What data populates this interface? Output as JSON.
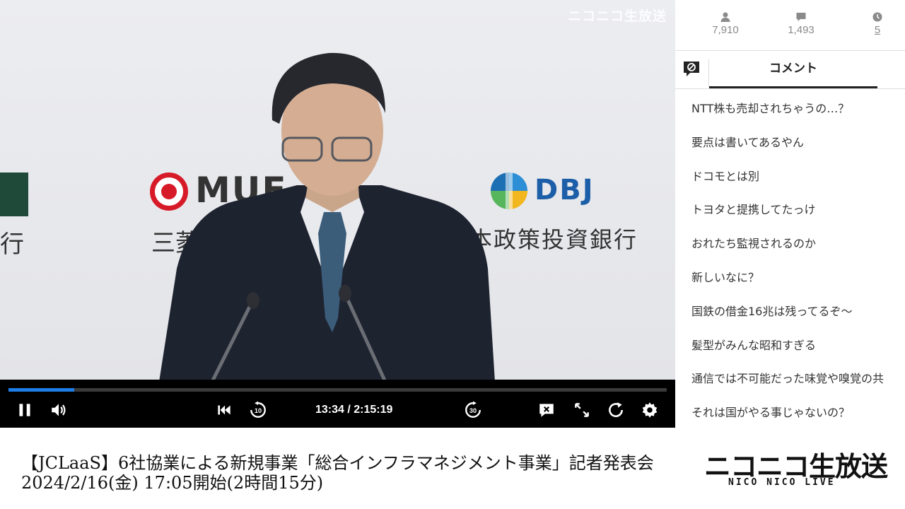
{
  "video": {
    "watermark": "ニコニコ生放送",
    "backdrop": {
      "left_kanji": "行",
      "mufg_text": "MUF",
      "mufg_jp": "三菱し",
      "dbj_text": "DBJ",
      "dbj_jp": "本政策投資銀行"
    }
  },
  "player": {
    "time": "13:34 / 2:15:19",
    "progress": 0.1,
    "buttons": {
      "pause": "pause-icon",
      "volume": "volume-icon",
      "previous": "skip-previous-icon",
      "rewind": "rewind-10-icon",
      "forward": "forward-30-icon",
      "comments_toggle": "comment-off-icon",
      "fullscreen": "fullscreen-icon",
      "reload": "reload-icon",
      "settings": "gear-icon"
    },
    "rewind_label": "10",
    "forward_label": "30"
  },
  "stats": {
    "viewers": "7,910",
    "comments": "1,493",
    "timeshift": "5"
  },
  "tabs": {
    "comment_label": "コメント"
  },
  "comments": [
    "NTT株も売却されちゃうの…？",
    "要点は書いてあるやん",
    "ドコモとは別",
    "トヨタと提携してたっけ",
    "おれたち監視されるのか",
    "新しいなに？",
    "国鉄の借金16兆は残ってるぞ～",
    "髪型がみんな昭和すぎる",
    "通信では不可能だった味覚や嗅覚の共",
    "それは国がやる事じゃないの？"
  ],
  "bottom": {
    "title_line1": "【JCLaaS】6社協業による新規事業「総合インフラマネジメント事業」記者発表会",
    "title_line2": "2024/2/16(金) 17:05開始(2時間15分)",
    "brand_main": "ニコニコ生放送",
    "brand_sub": "NICO NICO LIVE"
  },
  "colors": {
    "progress": "#1e7de6",
    "mufg_red": "#d71a28",
    "dbj_blue": "#1d5ea8"
  }
}
